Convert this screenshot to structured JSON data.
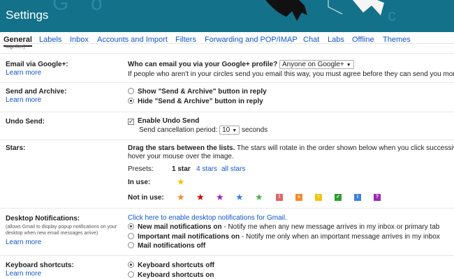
{
  "header": {
    "title": "Settings"
  },
  "tabs": [
    "General",
    "Labels",
    "Inbox",
    "Accounts and Import",
    "Filters",
    "Forwarding and POP/IMAP",
    "Chat",
    "Labs",
    "Offline",
    "Themes"
  ],
  "together_text": "together)",
  "email_google": {
    "label": "Email via Google+:",
    "learn": "Learn more",
    "question": "Who can email you via your Google+ profile?",
    "selected": "Anyone on Google+",
    "note": "If people who aren't in your circles send you email this way, you must agree before they can send you more"
  },
  "send_archive": {
    "label": "Send and Archive:",
    "learn": "Learn more",
    "options": [
      "Show \"Send & Archive\" button in reply",
      "Hide \"Send & Archive\" button in reply"
    ],
    "selected_index": 1
  },
  "undo_send": {
    "label": "Undo Send:",
    "enable": "Enable Undo Send",
    "enabled": true,
    "period_label": "Send cancellation period:",
    "period_value": "10",
    "period_unit": "seconds"
  },
  "stars": {
    "label": "Stars:",
    "desc1_bold": "Drag the stars between the lists.",
    "desc1_rest": "  The stars will rotate in the order shown below when you click successiv",
    "desc2": "hover your mouse over the image.",
    "presets_label": "Presets:",
    "presets": [
      "1 star",
      "4 stars",
      "all stars"
    ],
    "in_use_label": "In use:",
    "not_in_use_label": "Not in use:",
    "in_use_color": "#f4c20d",
    "not_in_use": [
      {
        "icon": "orange-star-icon",
        "color": "#f28c28",
        "type": "star",
        "glyph": "★"
      },
      {
        "icon": "red-star-icon",
        "color": "#d50000",
        "type": "star",
        "glyph": "★"
      },
      {
        "icon": "purple-star-icon",
        "color": "#9c27b0",
        "type": "star",
        "glyph": "★"
      },
      {
        "icon": "blue-star-icon",
        "color": "#3f7fe0",
        "type": "star",
        "glyph": "★"
      },
      {
        "icon": "green-star-icon",
        "color": "#4caf50",
        "type": "star",
        "glyph": "★"
      },
      {
        "icon": "red-bang-icon",
        "color": "#e06666",
        "type": "sq",
        "glyph": "!"
      },
      {
        "icon": "orange-guillemet-icon",
        "color": "#f28c28",
        "type": "sq",
        "glyph": "»"
      },
      {
        "icon": "yellow-bang-icon",
        "color": "#f4c20d",
        "type": "sq",
        "glyph": "!"
      },
      {
        "icon": "green-check-icon",
        "color": "#2e9e2e",
        "type": "sq",
        "glyph": "✓"
      },
      {
        "icon": "blue-info-icon",
        "color": "#3f7fe0",
        "type": "sq",
        "glyph": "i"
      },
      {
        "icon": "purple-question-icon",
        "color": "#9c27b0",
        "type": "sq",
        "glyph": "?"
      }
    ]
  },
  "desktop": {
    "label": "Desktop Notifications:",
    "sublabel": "(allows Gmail to display popup notifications on your desktop when new email messages arrive)",
    "learn": "Learn more",
    "enable_link": "Click here to enable desktop notifications for Gmail.",
    "options": [
      {
        "bold": "New mail notifications on",
        "rest": " - Notify me when any new message arrives in my inbox or primary tab"
      },
      {
        "bold": "Important mail notifications on",
        "rest": " - Notify me only when an important message arrives in my inbox"
      },
      {
        "bold": "Mail notifications off",
        "rest": ""
      }
    ],
    "selected_index": 0
  },
  "keyboard": {
    "label": "Keyboard shortcuts:",
    "learn": "Learn more",
    "options": [
      "Keyboard shortcuts off",
      "Keyboard shortcuts on"
    ],
    "selected_index": 0
  }
}
